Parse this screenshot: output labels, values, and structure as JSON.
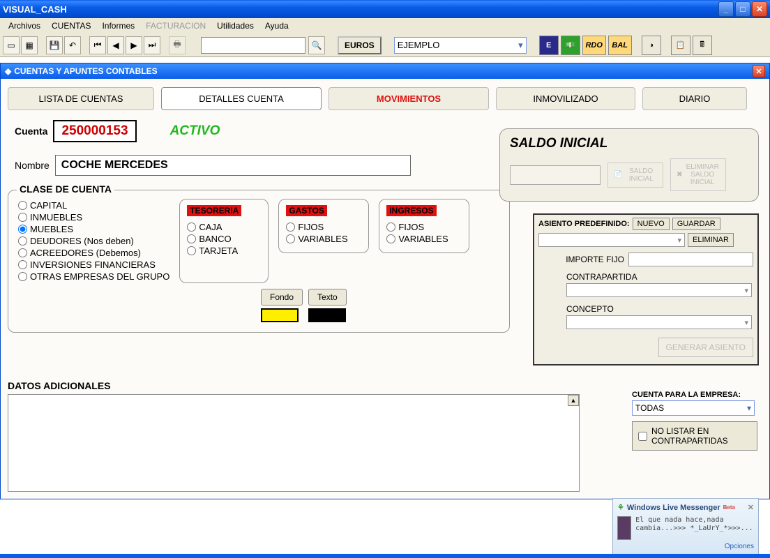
{
  "title": "VISUAL_CASH",
  "menus": [
    "Archivos",
    "CUENTAS",
    "Informes",
    "FACTURACION",
    "Utilidades",
    "Ayuda"
  ],
  "menus_disabled_index": 3,
  "toolbar": {
    "euros_btn": "EUROS",
    "company_combo": "EJEMPLO",
    "rdo": "RDO",
    "bal": "BAL"
  },
  "childtitle": "CUENTAS Y APUNTES CONTABLES",
  "tabs": [
    "LISTA DE CUENTAS",
    "DETALLES CUENTA",
    "MOVIMIENTOS",
    "INMOVILIZADO",
    "DIARIO"
  ],
  "active_tab_index": 1,
  "form": {
    "cuenta_lbl": "Cuenta",
    "cuenta": "250000153",
    "activo": "ACTIVO",
    "nombre_lbl": "Nombre",
    "nombre": "COCHE MERCEDES"
  },
  "saldo": {
    "title": "SALDO INICIAL",
    "btn1": "SALDO INICIAL",
    "btn2": "ELIMINAR SALDO INICIAL"
  },
  "clase": {
    "title": "CLASE DE CUENTA",
    "radios": [
      "CAPITAL",
      "INMUEBLES",
      "MUEBLES",
      "DEUDORES (Nos deben)",
      "ACREEDORES (Debemos)",
      "INVERSIONES FINANCIERAS",
      "OTRAS EMPRESAS DEL GRUPO"
    ],
    "selected_index": 2,
    "tesoreria": {
      "header": "TESORERIA",
      "opts": [
        "CAJA",
        "BANCO",
        "TARJETA"
      ]
    },
    "gastos": {
      "header": "GASTOS",
      "opts": [
        "FIJOS",
        "VARIABLES"
      ]
    },
    "ingresos": {
      "header": "INGRESOS",
      "opts": [
        "FIJOS",
        "VARIABLES"
      ]
    },
    "fondo_btn": "Fondo",
    "texto_btn": "Texto",
    "color_fondo": "#ffee00",
    "color_texto": "#000000"
  },
  "asiento": {
    "title": "ASIENTO PREDEFINIDO:",
    "nuevo": "NUEVO",
    "guardar": "GUARDAR",
    "eliminar": "ELIMINAR",
    "importe_lbl": "IMPORTE FIJO",
    "contra_lbl": "CONTRAPARTIDA",
    "concepto_lbl": "CONCEPTO",
    "generar": "GENERAR ASIENTO"
  },
  "datos_lbl": "DATOS ADICIONALES",
  "empresa": {
    "lbl": "CUENTA PARA LA EMPRESA:",
    "val": "TODAS",
    "nolistar": "NO LISTAR EN CONTRAPARTIDAS"
  },
  "toast": {
    "title": "Windows Live Messenger",
    "msg": "El que nada hace,nada cambia...>>> *_LaUrY_*>>>...",
    "opt": "Opciones"
  }
}
